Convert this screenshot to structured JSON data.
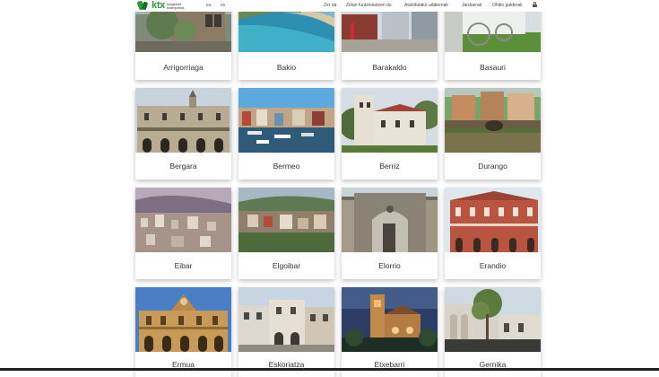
{
  "header": {
    "logo_text": "ktx",
    "logo_subtext": "eusgintzet kooerportiva",
    "languages": [
      "eu",
      "es"
    ],
    "nav": [
      "Zer da",
      "Zelan funtzionatzen du",
      "Atxikitutako udalerriak",
      "Jarduerak",
      "Ohiko galderak"
    ]
  },
  "cards": [
    {
      "label": "Arrigorriaga"
    },
    {
      "label": "Bakio"
    },
    {
      "label": "Barakaldo"
    },
    {
      "label": "Basauri"
    },
    {
      "label": "Bergara"
    },
    {
      "label": "Bermeo"
    },
    {
      "label": "Berriz"
    },
    {
      "label": "Durango"
    },
    {
      "label": "Eibar"
    },
    {
      "label": "Elgoibar"
    },
    {
      "label": "Elorrio"
    },
    {
      "label": "Erandio"
    },
    {
      "label": "Ermua"
    },
    {
      "label": "Eskoriatza"
    },
    {
      "label": "Etxebarri"
    },
    {
      "label": "Gernika"
    }
  ]
}
